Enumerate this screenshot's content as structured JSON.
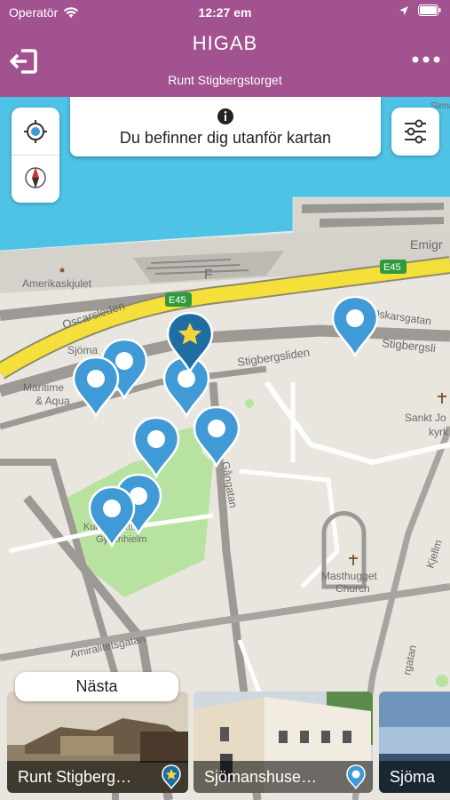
{
  "status_bar": {
    "carrier": "Operatör",
    "time": "12:27 em"
  },
  "nav": {
    "title": "HIGAB",
    "subtitle": "Runt Stigbergstorget"
  },
  "notice": {
    "text": "Du befinner dig utanför kartan"
  },
  "map_labels": {
    "amerikaskjulet": "Amerikaskjulet",
    "oscarsleden": "Oscarsleden",
    "e45_a": "E45",
    "e45_b": "E45",
    "oskarsgatan": "Oskarsgatan",
    "stigbergsliden": "Stigbergsliden",
    "stigbergsli": "Stigbergsli",
    "sjoma": "Sjöma",
    "maritime": "Maritime",
    "aqua": "& Aqua",
    "emigr": "Emigr",
    "f": "F",
    "sankt_j": "Sankt Jo",
    "kyrk": "kyrk",
    "masthugget": "Masthugget",
    "church": "Church",
    "ganggatan": "Gångatan",
    "amiralitetsgatan": "Amiralitetsgatan",
    "kjellm": "Kjellm",
    "platsgatan": "rgatan",
    "park_a": "Kungsparatet",
    "park_b": "Gyllenhielm",
    "stena": "Stena"
  },
  "next_button": {
    "label": "Nästa"
  },
  "cards": [
    {
      "title": "Runt Stigberg…",
      "icon": "star-pin-icon"
    },
    {
      "title": "Sjömanshuse…",
      "icon": "pin-icon"
    },
    {
      "title": "Sjöma"
    }
  ],
  "colors": {
    "header": "#a2528f",
    "water": "#4fc3e6",
    "park": "#b8e2a0",
    "pin": "#3f9ad6",
    "pin_active": "#1f6da3",
    "road": "#f5df3a"
  }
}
